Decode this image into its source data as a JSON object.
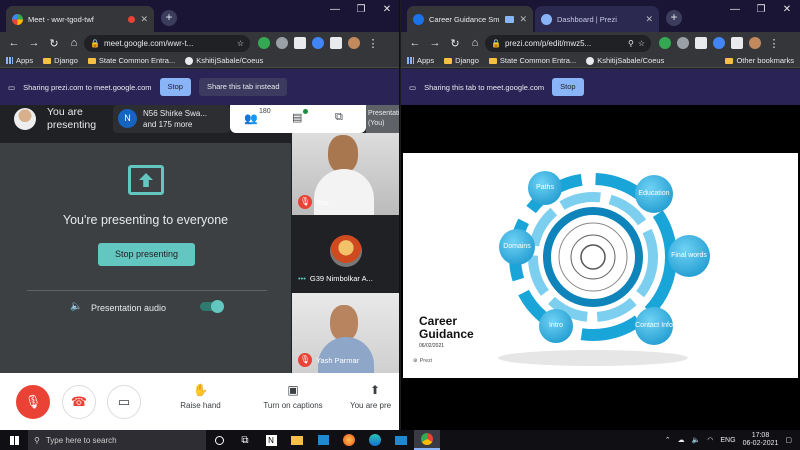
{
  "left": {
    "tabs": [
      {
        "title": "Meet - wwr-tgod-twf",
        "active": true
      }
    ],
    "url": "meet.google.com/wwr-t...",
    "bookmarks": [
      "Apps",
      "Django",
      "State Common Entra...",
      "KshitijSabale/Coeus"
    ],
    "share": {
      "text": "Sharing prezi.com to meet.google.com",
      "stop": "Stop",
      "share_tab": "Share this tab instead"
    },
    "meet": {
      "presenting_line1": "You are",
      "presenting_line2": "presenting",
      "participant_initial": "N",
      "participant_name": "N56 Shirke Swa...",
      "participant_more": "and 175 more",
      "people_count": "180",
      "self_tile_label": "Presentation",
      "self_tile_label2": "(You)",
      "presenting_text": "You're presenting to everyone",
      "stop_presenting": "Stop presenting",
      "presentation_audio": "Presentation audio",
      "tiles": [
        {
          "name": "You"
        },
        {
          "name": "G39 Nimbolkar A..."
        },
        {
          "name": "Yash Parmar"
        }
      ],
      "controls": [
        "Raise hand",
        "Turn on captions",
        "You are pre"
      ]
    }
  },
  "right": {
    "tabs": [
      {
        "title": "Career Guidance Smit...",
        "active": true
      },
      {
        "title": "Dashboard | Prezi",
        "active": false
      }
    ],
    "url": "prezi.com/p/edit/mwz5...",
    "bookmarks": [
      "Apps",
      "Django",
      "State Common Entra...",
      "KshitijSabale/Coeus"
    ],
    "other_bookmarks": "Other bookmarks",
    "share": {
      "text": "Sharing this tab to meet.google.com",
      "stop": "Stop"
    },
    "slide": {
      "title_line1": "Career",
      "title_line2": "Guidance",
      "date": "06/02/2021",
      "logo": "Prezi",
      "nodes": [
        "Paths",
        "Education",
        "Domains",
        "Final words",
        "Intro",
        "Contact Info"
      ]
    }
  },
  "other_bookmarks": "Other bookmarks",
  "taskbar": {
    "search_placeholder": "Type here to search",
    "lang": "ENG",
    "time": "17:08",
    "date": "06-02-2021"
  }
}
